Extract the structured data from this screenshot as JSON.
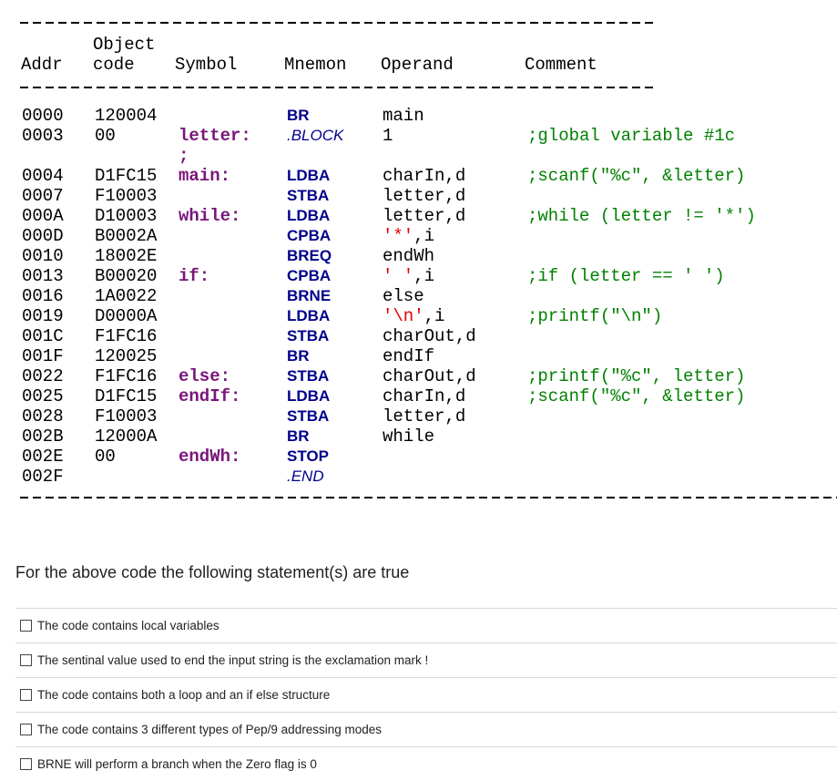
{
  "listing": {
    "headers": {
      "addr": "Addr",
      "object_line1": "Object",
      "object_line2": "code",
      "symbol": "Symbol",
      "mnemon": "Mnemon",
      "operand": "Operand",
      "comment": "Comment"
    },
    "rows": [
      {
        "addr": "0000",
        "obj": "120004",
        "sym": "",
        "mnem": "BR",
        "oper": "main",
        "cmt": ""
      },
      {
        "addr": "0003",
        "obj": "00",
        "sym": "letter:",
        "mnem": ".BLOCK",
        "oper": "1",
        "cmt": ";global variable #1c"
      },
      {
        "addr": "",
        "obj": "",
        "sym": ";",
        "mnem": "",
        "oper": "",
        "cmt": ""
      },
      {
        "addr": "0004",
        "obj": "D1FC15",
        "sym": "main:",
        "mnem": "LDBA",
        "oper": "charIn,d",
        "cmt": ";scanf(\"%c\", &letter)"
      },
      {
        "addr": "0007",
        "obj": "F10003",
        "sym": "",
        "mnem": "STBA",
        "oper": "letter,d",
        "cmt": ""
      },
      {
        "addr": "000A",
        "obj": "D10003",
        "sym": "while:",
        "mnem": "LDBA",
        "oper": "letter,d",
        "cmt": ";while (letter != '*')"
      },
      {
        "addr": "000D",
        "obj": "B0002A",
        "sym": "",
        "mnem": "CPBA",
        "oper_str": "'*'",
        "oper_rest": ",i",
        "cmt": ""
      },
      {
        "addr": "0010",
        "obj": "18002E",
        "sym": "",
        "mnem": "BREQ",
        "oper": "endWh",
        "cmt": ""
      },
      {
        "addr": "0013",
        "obj": "B00020",
        "sym": "if:",
        "mnem": "CPBA",
        "oper_str": "' '",
        "oper_rest": ",i",
        "cmt": ";if (letter == ' ')"
      },
      {
        "addr": "0016",
        "obj": "1A0022",
        "sym": "",
        "mnem": "BRNE",
        "oper": "else",
        "cmt": ""
      },
      {
        "addr": "0019",
        "obj": "D0000A",
        "sym": "",
        "mnem": "LDBA",
        "oper_str": "'\\n'",
        "oper_rest": ",i",
        "cmt": ";printf(\"\\n\")"
      },
      {
        "addr": "001C",
        "obj": "F1FC16",
        "sym": "",
        "mnem": "STBA",
        "oper": "charOut,d",
        "cmt": ""
      },
      {
        "addr": "001F",
        "obj": "120025",
        "sym": "",
        "mnem": "BR",
        "oper": "endIf",
        "cmt": ""
      },
      {
        "addr": "0022",
        "obj": "F1FC16",
        "sym": "else:",
        "mnem": "STBA",
        "oper": "charOut,d",
        "cmt": ";printf(\"%c\", letter)"
      },
      {
        "addr": "0025",
        "obj": "D1FC15",
        "sym": "endIf:",
        "mnem": "LDBA",
        "oper": "charIn,d",
        "cmt": ";scanf(\"%c\", &letter)"
      },
      {
        "addr": "0028",
        "obj": "F10003",
        "sym": "",
        "mnem": "STBA",
        "oper": "letter,d",
        "cmt": ""
      },
      {
        "addr": "002B",
        "obj": "12000A",
        "sym": "",
        "mnem": "BR",
        "oper": "while",
        "cmt": ""
      },
      {
        "addr": "002E",
        "obj": "00",
        "sym": "endWh:",
        "mnem": "STOP",
        "oper": "",
        "cmt": ""
      },
      {
        "addr": "002F",
        "obj": "",
        "sym": "",
        "mnem": ".END",
        "oper": "",
        "cmt": ""
      }
    ]
  },
  "question": {
    "prompt": "For the above code the following statement(s) are true",
    "options": [
      "The code contains local variables",
      "The sentinal value used to end the input string is the exclamation mark !",
      "The code contains both a loop and an if else structure",
      "The code contains 3 different types of Pep/9 addressing modes",
      "BRNE will perform a branch when the Zero flag is 0"
    ]
  }
}
